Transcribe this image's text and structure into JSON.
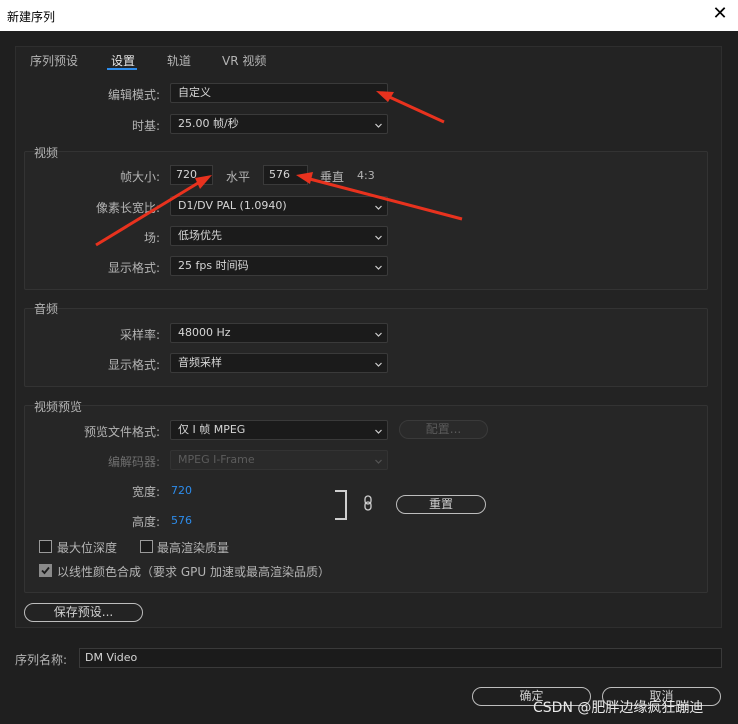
{
  "window": {
    "title": "新建序列",
    "close_glyph": "✕"
  },
  "tabs": [
    "序列预设",
    "设置",
    "轨道",
    "VR 视频"
  ],
  "general": {
    "edit_mode_label": "编辑模式:",
    "edit_mode_value": "自定义",
    "timebase_label": "时基:",
    "timebase_value": "25.00  帧/秒"
  },
  "video": {
    "group_title": "视频",
    "frame_size_label": "帧大小:",
    "width_value": "720",
    "horizontal_label": "水平",
    "height_value": "576",
    "vertical_label": "垂直",
    "aspect_ratio": "4:3",
    "pixel_aspect_label": "像素长宽比:",
    "pixel_aspect_value": "D1/DV PAL (1.0940)",
    "fields_label": "场:",
    "fields_value": "低场优先",
    "display_format_label": "显示格式:",
    "display_format_value": "25 fps 时间码"
  },
  "audio": {
    "group_title": "音频",
    "sample_rate_label": "采样率:",
    "sample_rate_value": "48000 Hz",
    "display_format_label": "显示格式:",
    "display_format_value": "音频采样"
  },
  "preview": {
    "group_title": "视频预览",
    "file_format_label": "预览文件格式:",
    "file_format_value": "仅 I 帧 MPEG",
    "configure_button": "配置...",
    "codec_label": "编解码器:",
    "codec_value": "MPEG I-Frame",
    "width_label": "宽度:",
    "width_value": "720",
    "height_label": "高度:",
    "height_value": "576",
    "reset_button": "重置",
    "max_bit_depth_label": "最大位深度",
    "max_bit_depth_checked": false,
    "max_render_quality_label": "最高渲染质量",
    "max_render_quality_checked": false,
    "linear_color_label": "以线性颜色合成（要求 GPU 加速或最高渲染品质）",
    "linear_color_checked": true
  },
  "save_preset_button": "保存预设...",
  "sequence_name": {
    "label": "序列名称:",
    "value": "DM Video"
  },
  "ok_button": "确定",
  "cancel_button": "取消",
  "watermark": "CSDN @肥胖边缘疯狂蹦迪",
  "colors": {
    "accent": "#2d8ceb",
    "arrow": "#e8321e",
    "background": "#1f1f1f"
  },
  "icons": [
    "close-icon",
    "chevron-down-icon",
    "link-icon",
    "check-icon"
  ]
}
